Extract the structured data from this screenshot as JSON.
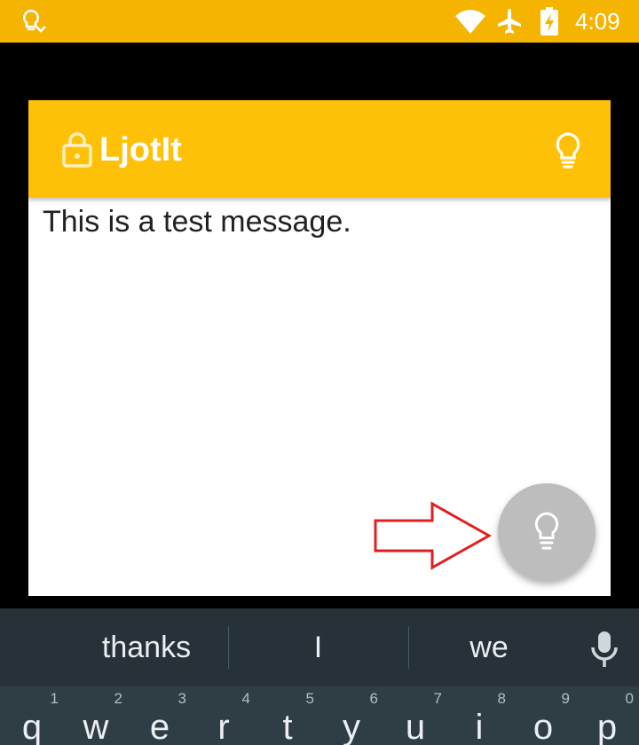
{
  "status_bar": {
    "time": "4:09",
    "icons": [
      "lightbulb-notification-icon",
      "wifi-icon",
      "airplane-mode-icon",
      "battery-charging-icon"
    ],
    "color": "#F4B400"
  },
  "dialog": {
    "app_title": "LjotIt",
    "header_color": "#FFC107",
    "note_text": "This is a test message.",
    "fab_color": "#BDBDBD"
  },
  "annotation": {
    "arrow_color": "#E02020"
  },
  "keyboard": {
    "suggestions": [
      "thanks",
      "I",
      "we"
    ],
    "keys": [
      {
        "letter": "q",
        "hint": "1"
      },
      {
        "letter": "w",
        "hint": "2"
      },
      {
        "letter": "e",
        "hint": "3"
      },
      {
        "letter": "r",
        "hint": "4"
      },
      {
        "letter": "t",
        "hint": "5"
      },
      {
        "letter": "y",
        "hint": "6"
      },
      {
        "letter": "u",
        "hint": "7"
      },
      {
        "letter": "i",
        "hint": "8"
      },
      {
        "letter": "o",
        "hint": "9"
      },
      {
        "letter": "p",
        "hint": "0"
      }
    ]
  }
}
